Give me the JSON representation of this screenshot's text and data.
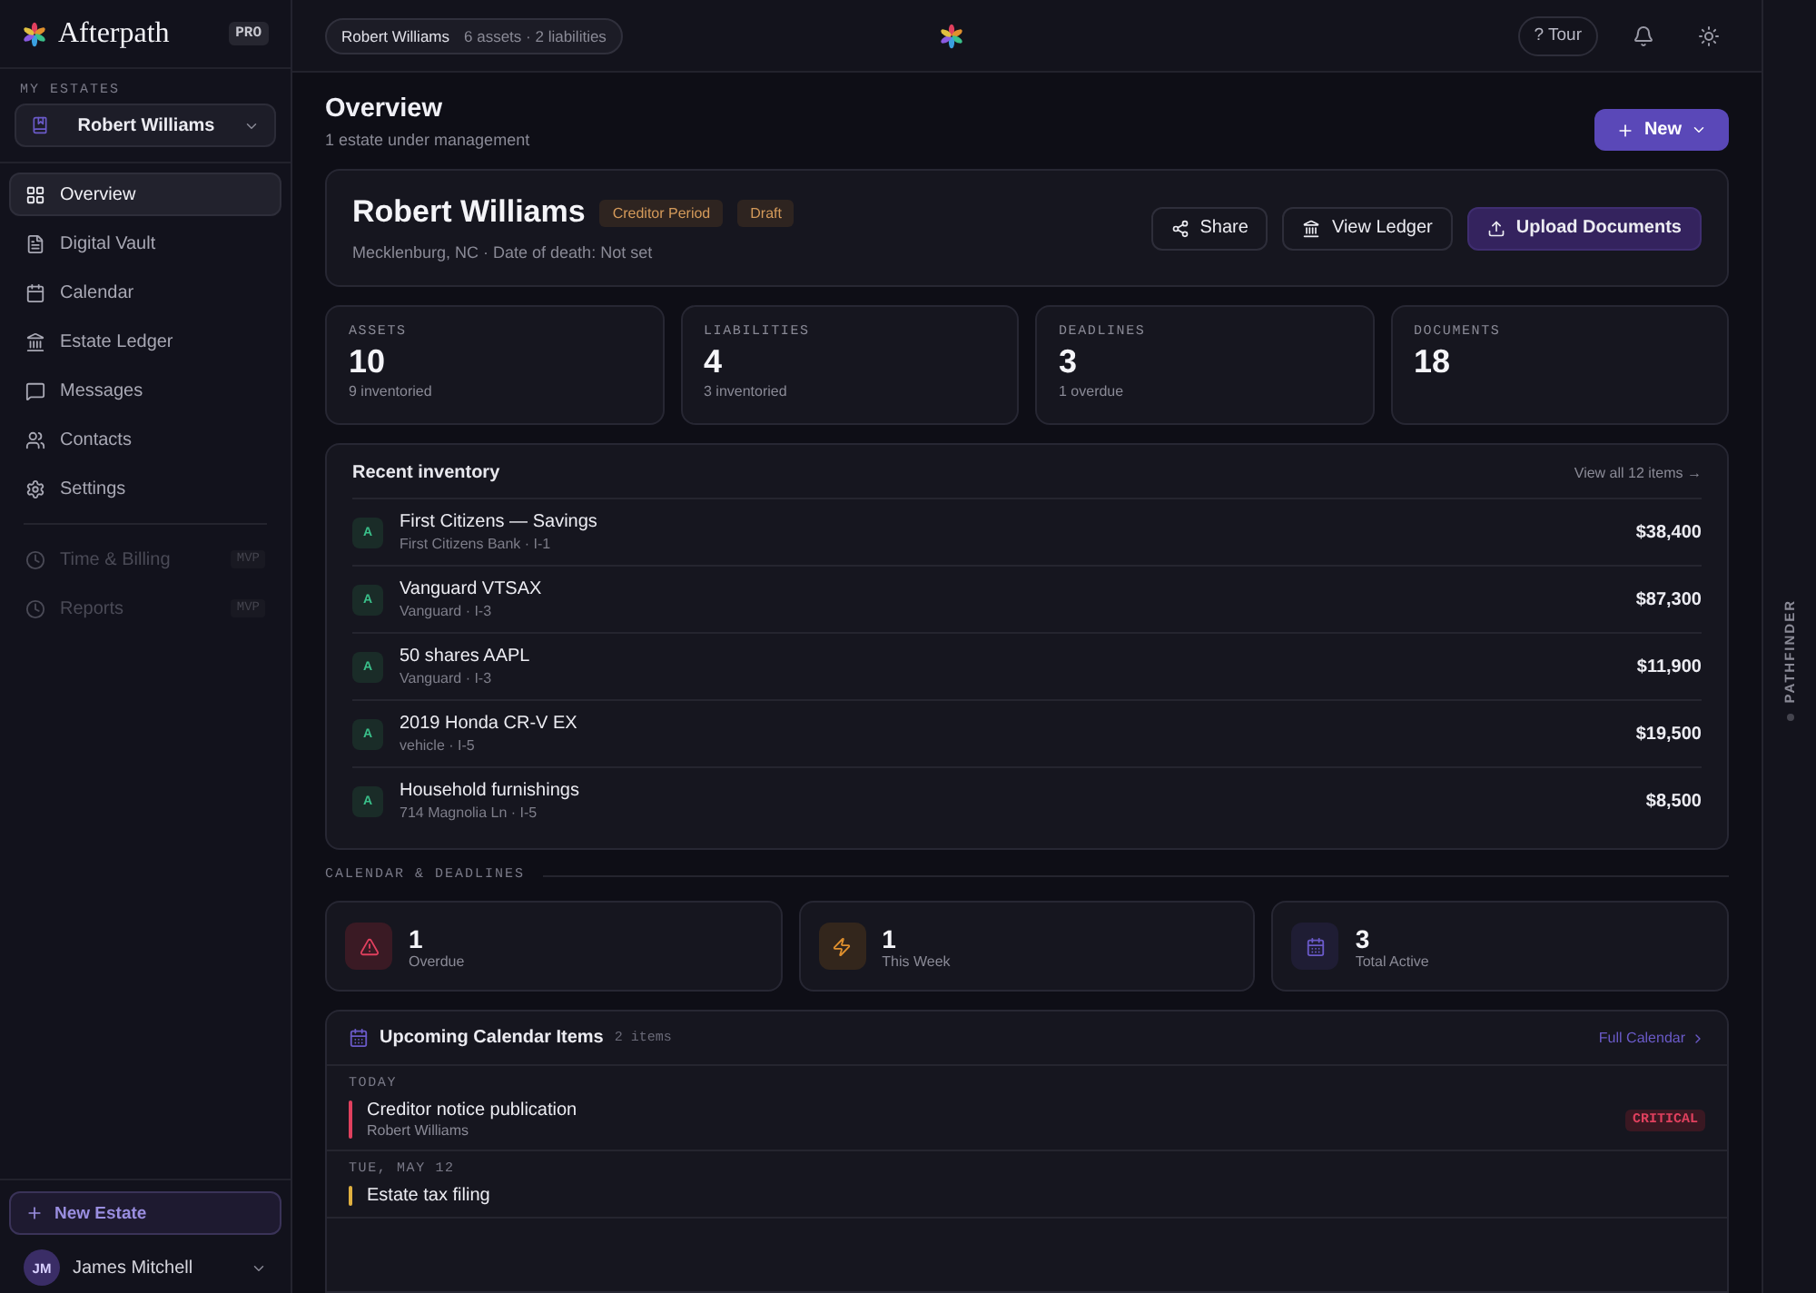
{
  "brand": {
    "name": "Afterpath",
    "plan": "PRO"
  },
  "sidebar": {
    "section_label": "MY ESTATES",
    "estate_select": "Robert Williams",
    "nav": [
      {
        "label": "Overview",
        "selected": true
      },
      {
        "label": "Digital Vault",
        "selected": false
      },
      {
        "label": "Calendar",
        "selected": false
      },
      {
        "label": "Estate Ledger",
        "selected": false
      },
      {
        "label": "Messages",
        "selected": false
      },
      {
        "label": "Contacts",
        "selected": false
      },
      {
        "label": "Settings",
        "selected": false
      }
    ],
    "extra_nav": [
      {
        "label": "Time & Billing",
        "badge": "MVP",
        "disabled": true
      },
      {
        "label": "Reports",
        "badge": "MVP",
        "disabled": true
      }
    ],
    "new_estate": "New Estate",
    "user": {
      "initials": "JM",
      "name": "James Mitchell"
    }
  },
  "topbar": {
    "estate_chip": "Robert Williams",
    "estate_summary": "6 assets · 2 liabilities",
    "tour_glyph": "?",
    "tour": "Tour"
  },
  "header": {
    "title": "Overview",
    "subtitle": "1 estate under management",
    "new_button": "New"
  },
  "estate": {
    "name": "Robert Williams",
    "tags": [
      {
        "label": "Creditor Period"
      },
      {
        "label": "Draft"
      }
    ],
    "details": "Mecklenburg, NC · Date of death: Not set",
    "actions": [
      {
        "label": "Share",
        "kind": "share"
      },
      {
        "label": "View Ledger",
        "kind": "ledger"
      },
      {
        "label": "Upload Documents",
        "kind": "upload"
      }
    ]
  },
  "stats": [
    {
      "label": "ASSETS",
      "value": "10",
      "note": "9 inventoried"
    },
    {
      "label": "LIABILITIES",
      "value": "4",
      "note": "3 inventoried"
    },
    {
      "label": "DEADLINES",
      "value": "3",
      "note": "1 overdue"
    },
    {
      "label": "DOCUMENTS",
      "value": "18"
    }
  ],
  "inventory": {
    "title": "Recent inventory",
    "link": "View all 12 items →",
    "rows": [
      {
        "badge": "A",
        "name": "First Citizens — Savings",
        "detail": "First Citizens Bank · I-1",
        "amount": "$38,400"
      },
      {
        "badge": "A",
        "name": "Vanguard VTSAX",
        "detail": "Vanguard · I-3",
        "amount": "$87,300"
      },
      {
        "badge": "A",
        "name": "50 shares AAPL",
        "detail": "Vanguard · I-3",
        "amount": "$11,900"
      },
      {
        "badge": "A",
        "name": "2019 Honda CR-V EX",
        "detail": "vehicle · I-5",
        "amount": "$19,500"
      },
      {
        "badge": "A",
        "name": "Household furnishings",
        "detail": "714 Magnolia Ln · I-5",
        "amount": "$8,500"
      }
    ]
  },
  "calendar_section": "CALENDAR & DEADLINES",
  "calendar_stats": [
    {
      "kind": "overdue",
      "value": "1",
      "label": "Overdue"
    },
    {
      "kind": "week",
      "value": "1",
      "label": "This Week"
    },
    {
      "kind": "total",
      "value": "3",
      "label": "Total Active"
    }
  ],
  "upcoming": {
    "title": "Upcoming Calendar Items",
    "count": "2 items",
    "link": "Full Calendar",
    "groups": [
      {
        "date": "TODAY",
        "items": [
          {
            "title": "Creditor notice publication",
            "subtitle": "Robert Williams",
            "priority": "CRITICAL",
            "color": "#e0405e"
          }
        ]
      },
      {
        "date": "TUE, MAY 12",
        "items": [
          {
            "title": "Estate tax filing",
            "color": "#e0b040"
          }
        ]
      }
    ]
  },
  "rail": {
    "label": "PATHFINDER"
  }
}
